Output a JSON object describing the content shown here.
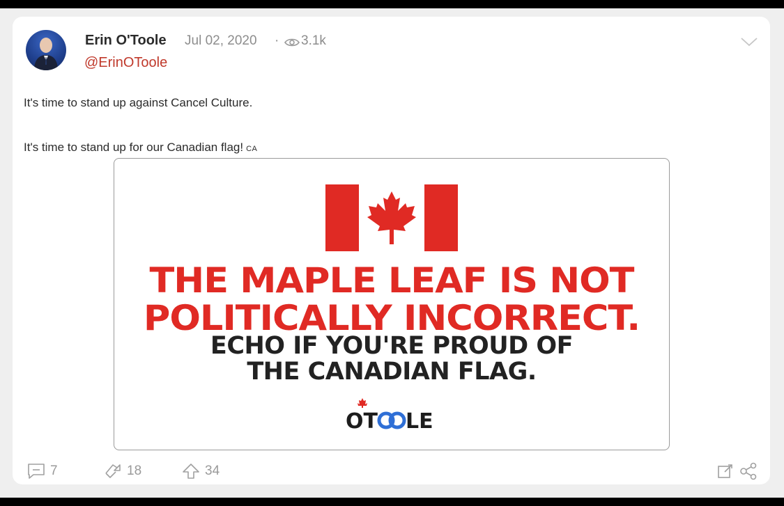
{
  "post": {
    "author_name": "Erin O'Toole",
    "date": "Jul 02, 2020",
    "separator": "·",
    "views": "3.1k",
    "handle": "@ErinOToole",
    "text_line_1": "It's time to stand up against Cancel Culture.",
    "text_line_2": "It's time to stand up for our Canadian flag!",
    "flag_tag": "CA"
  },
  "image": {
    "headline_red_1": "THE MAPLE LEAF IS NOT",
    "headline_red_2": "POLITICALLY INCORRECT.",
    "headline_dark_1": "ECHO IF YOU'RE PROUD OF",
    "headline_dark_2": "THE CANADIAN FLAG.",
    "logo_text": "OTOOLE"
  },
  "actions": {
    "comments": "7",
    "reshares": "18",
    "upvotes": "34"
  },
  "icons": {
    "views": "eye-icon",
    "menu": "chevron-down-icon",
    "comments": "comment-icon",
    "reshares": "echo-icon",
    "upvotes": "upvote-icon",
    "edit": "edit-icon",
    "share": "share-icon"
  },
  "colors": {
    "handle": "#c0392b",
    "flag_red": "#e02a24",
    "muted": "#8d8d8d"
  }
}
